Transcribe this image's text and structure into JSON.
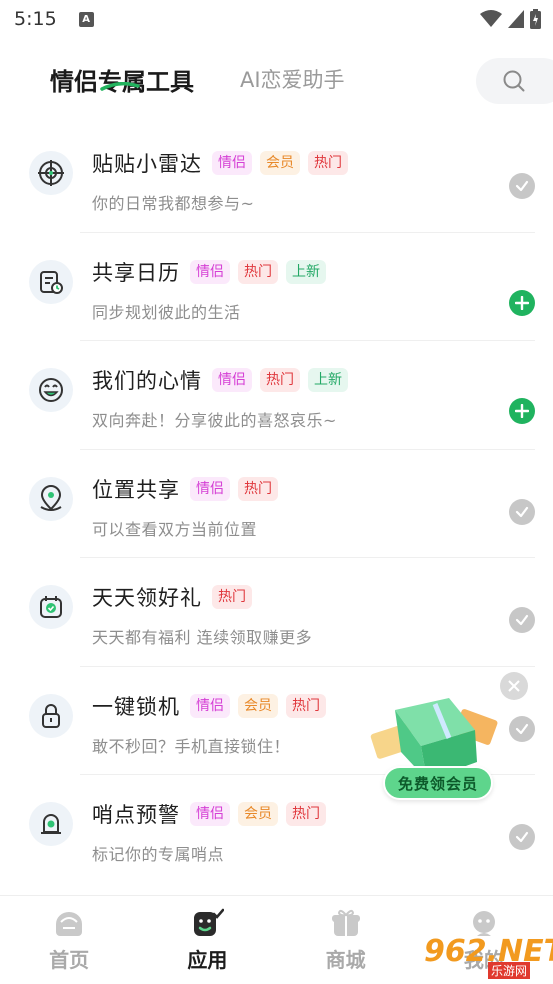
{
  "status": {
    "time": "5:15",
    "notif_letter": "A"
  },
  "header": {
    "tab_active": "情侣专属工具",
    "tab_inactive": "AI恋爱助手"
  },
  "tools": [
    {
      "title": "贴贴小雷达",
      "tags": [
        "情侣",
        "会员",
        "热门"
      ],
      "desc": "你的日常我都想参与~",
      "icon": "radar-icon",
      "added": true
    },
    {
      "title": "共享日历",
      "tags": [
        "情侣",
        "热门",
        "上新"
      ],
      "desc": "同步规划彼此的生活",
      "icon": "calendar-icon",
      "added": false
    },
    {
      "title": "我们的心情",
      "tags": [
        "情侣",
        "热门",
        "上新"
      ],
      "desc": "双向奔赴！分享彼此的喜怒哀乐~",
      "icon": "smile-icon",
      "added": false
    },
    {
      "title": "位置共享",
      "tags": [
        "情侣",
        "热门"
      ],
      "desc": "可以查看双方当前位置",
      "icon": "location-icon",
      "added": true
    },
    {
      "title": "天天领好礼",
      "tags": [
        "热门"
      ],
      "desc": "天天都有福利 连续领取赚更多",
      "icon": "gift-calendar-icon",
      "added": true
    },
    {
      "title": "一键锁机",
      "tags": [
        "情侣",
        "会员",
        "热门"
      ],
      "desc": "敢不秒回？手机直接锁住！",
      "icon": "lock-icon",
      "added": true
    },
    {
      "title": "哨点预警",
      "tags": [
        "情侣",
        "会员",
        "热门"
      ],
      "desc": "标记你的专属哨点",
      "icon": "alarm-icon",
      "added": true
    }
  ],
  "promo": {
    "label": "免费领会员"
  },
  "nav": [
    {
      "label": "首页",
      "icon": "home-icon",
      "active": false
    },
    {
      "label": "应用",
      "icon": "apps-icon",
      "active": true
    },
    {
      "label": "商城",
      "icon": "store-icon",
      "active": false
    },
    {
      "label": "我的",
      "icon": "profile-icon",
      "active": false
    }
  ],
  "watermark": {
    "text": "962.NET",
    "sub": "乐游网"
  },
  "colors": {
    "accent_green": "#20b35f",
    "tag_couple": "#d53fd5",
    "tag_vip": "#e8892a",
    "tag_hot": "#e0393e",
    "tag_new": "#23a866"
  }
}
